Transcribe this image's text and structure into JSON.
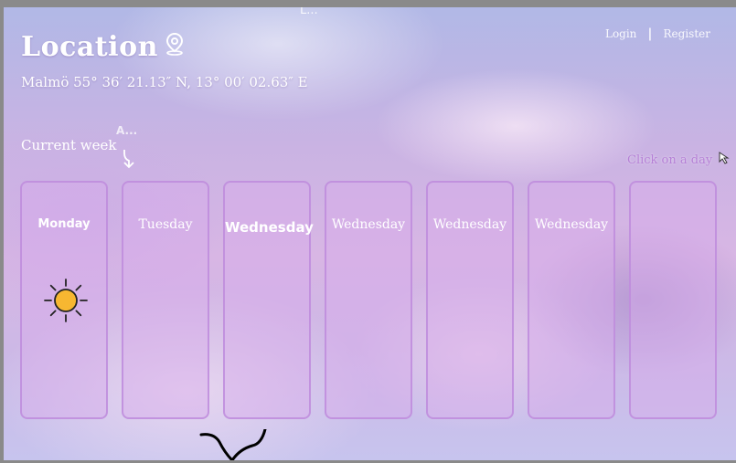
{
  "top_label": "L...",
  "header": {
    "title": "Location",
    "title_icon": "location-pin-icon",
    "coordinates": "Malmö 55° 36′ 21.13″ N, 13° 00′ 02.63″ E"
  },
  "auth": {
    "login": "Login",
    "separator": "|",
    "register": "Register"
  },
  "week": {
    "label": "Current week",
    "abbr": "A...",
    "arrow_icon": "arrow-down-icon"
  },
  "hint": {
    "text": "Click on a day",
    "icon": "cursor-icon"
  },
  "days": [
    {
      "label": "Monday",
      "weather_icon": "sun-icon"
    },
    {
      "label": "Tuesday"
    },
    {
      "label": "Wednesday"
    },
    {
      "label": "Wednesday"
    },
    {
      "label": "Wednesday"
    },
    {
      "label": "Wednesday"
    },
    {
      "label": ""
    }
  ],
  "colors": {
    "accent": "#b580d6",
    "card_border": "#be8cdc",
    "sun": "#f7b731"
  }
}
